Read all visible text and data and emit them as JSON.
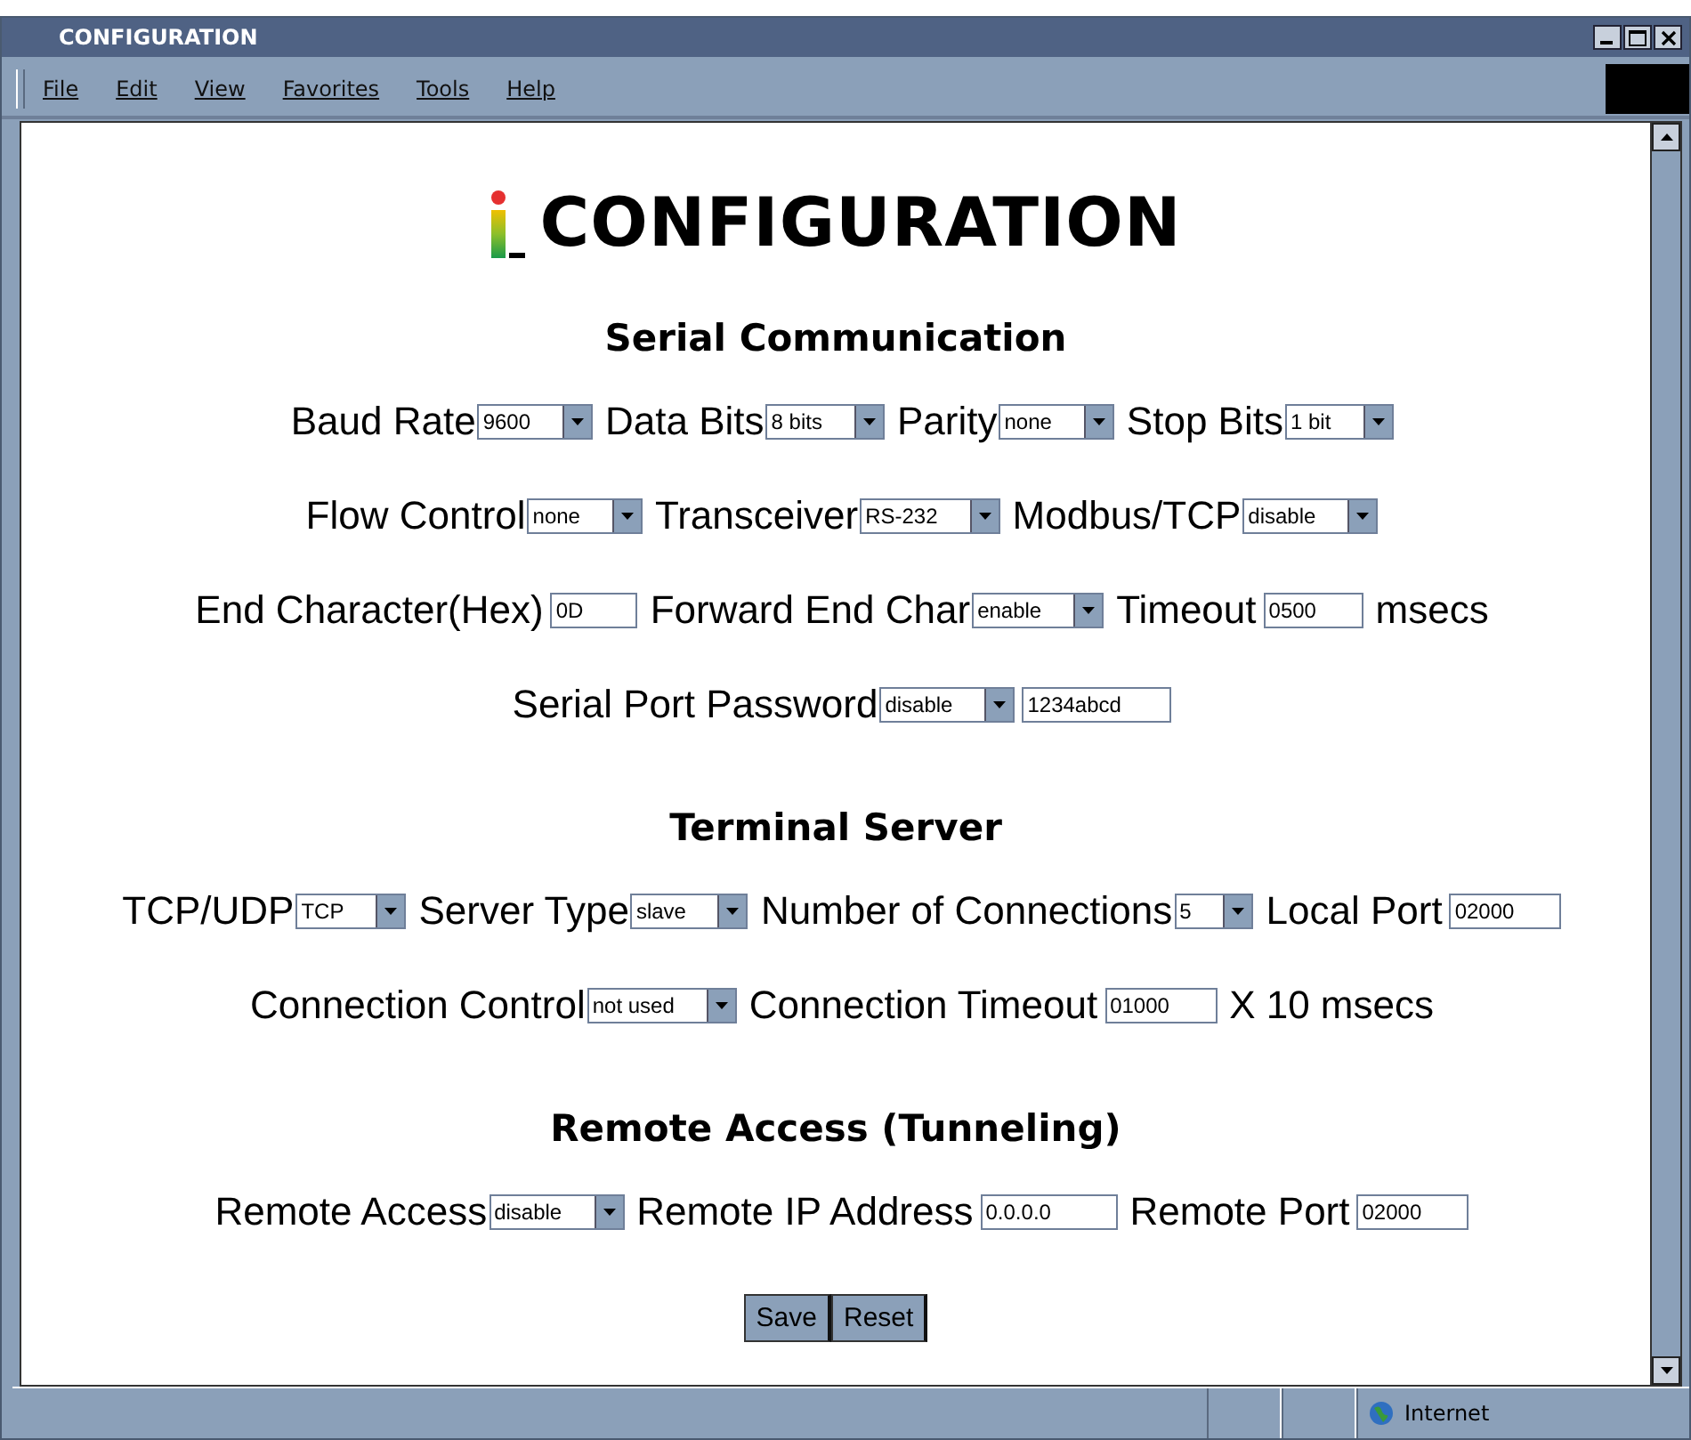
{
  "window": {
    "title": "CONFIGURATION"
  },
  "menu": [
    "File",
    "Edit",
    "View",
    "Favorites",
    "Tools",
    "Help"
  ],
  "page_title": "CONFIGURATION",
  "sections": [
    {
      "heading": "Serial Communication",
      "rows": [
        {
          "items": [
            {
              "kind": "label",
              "text": "Baud Rate"
            },
            {
              "kind": "select",
              "value": "9600"
            },
            {
              "kind": "label",
              "text": "Data Bits"
            },
            {
              "kind": "select",
              "value": "8 bits"
            },
            {
              "kind": "label",
              "text": "Parity"
            },
            {
              "kind": "select",
              "value": "none"
            },
            {
              "kind": "label",
              "text": "Stop Bits"
            },
            {
              "kind": "select",
              "value": "1 bit"
            }
          ]
        },
        {
          "items": [
            {
              "kind": "label",
              "text": "Flow Control"
            },
            {
              "kind": "select",
              "value": "none"
            },
            {
              "kind": "label",
              "text": "Transceiver"
            },
            {
              "kind": "select",
              "value": "RS-232"
            },
            {
              "kind": "label",
              "text": "Modbus/TCP"
            },
            {
              "kind": "select",
              "value": "disable"
            }
          ]
        },
        {
          "items": [
            {
              "kind": "label",
              "text": "End Character(Hex)"
            },
            {
              "kind": "input",
              "value": "0D"
            },
            {
              "kind": "label",
              "text": "Forward End Char"
            },
            {
              "kind": "select",
              "value": "enable"
            },
            {
              "kind": "label",
              "text": "Timeout"
            },
            {
              "kind": "input",
              "value": "0500"
            },
            {
              "kind": "label",
              "text": "msecs"
            }
          ]
        },
        {
          "items": [
            {
              "kind": "label",
              "text": "Serial Port Password"
            },
            {
              "kind": "select",
              "value": "disable"
            },
            {
              "kind": "input",
              "value": "1234abcd"
            }
          ]
        }
      ]
    },
    {
      "heading": "Terminal Server",
      "rows": [
        {
          "items": [
            {
              "kind": "label",
              "text": "TCP/UDP"
            },
            {
              "kind": "select",
              "value": "TCP"
            },
            {
              "kind": "label",
              "text": "Server Type"
            },
            {
              "kind": "select",
              "value": "slave"
            },
            {
              "kind": "label",
              "text": "Number of Connections"
            },
            {
              "kind": "select",
              "value": "5"
            },
            {
              "kind": "label",
              "text": "Local Port"
            },
            {
              "kind": "input",
              "value": "02000"
            }
          ]
        },
        {
          "items": [
            {
              "kind": "label",
              "text": "Connection Control"
            },
            {
              "kind": "select",
              "value": "not used"
            },
            {
              "kind": "label",
              "text": "Connection Timeout"
            },
            {
              "kind": "input",
              "value": "01000"
            },
            {
              "kind": "label",
              "text": "X 10 msecs"
            }
          ]
        }
      ]
    },
    {
      "heading": "Remote Access (Tunneling)",
      "rows": [
        {
          "items": [
            {
              "kind": "label",
              "text": "Remote Access"
            },
            {
              "kind": "select",
              "value": "disable"
            },
            {
              "kind": "label",
              "text": "Remote IP Address"
            },
            {
              "kind": "input",
              "value": "0.0.0.0"
            },
            {
              "kind": "label",
              "text": "Remote Port"
            },
            {
              "kind": "input",
              "value": "02000"
            }
          ]
        }
      ]
    }
  ],
  "buttons": [
    "Save",
    "Reset"
  ],
  "status_bar": {
    "zone": "Internet"
  }
}
